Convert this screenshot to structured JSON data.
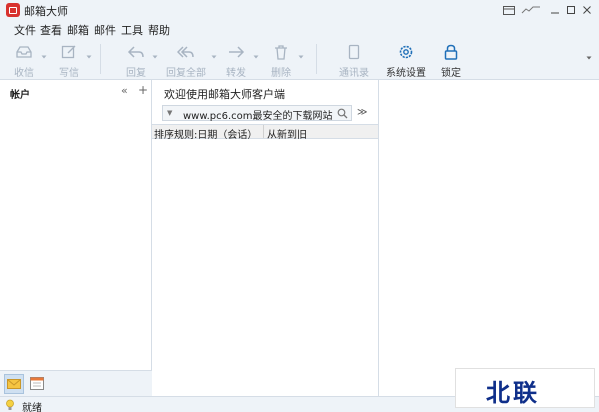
{
  "app": {
    "title": "邮箱大师"
  },
  "menu": [
    "文件",
    "查看",
    "邮箱",
    "邮件",
    "工具",
    "帮助"
  ],
  "toolbar": {
    "receive": "收信",
    "compose": "写信",
    "reply": "回复",
    "reply_all": "回复全部",
    "forward": "转发",
    "delete": "删除",
    "contacts": "通讯录",
    "settings": "系统设置",
    "lock": "锁定"
  },
  "left": {
    "title": "帐户"
  },
  "mid": {
    "welcome": "欢迎使用邮箱大师客户端",
    "search_value": "www.pc6.com最安全的下载网站",
    "sort_rule": "排序规则:日期（会话）",
    "sort_order": "从新到旧"
  },
  "status": {
    "text": "就绪"
  },
  "watermark": {
    "text": "北联"
  },
  "colors": {
    "brand": "#d8322f",
    "accent": "#1f6fb8",
    "chrome": "#eef3f8",
    "disabled": "#a8b4c2"
  }
}
